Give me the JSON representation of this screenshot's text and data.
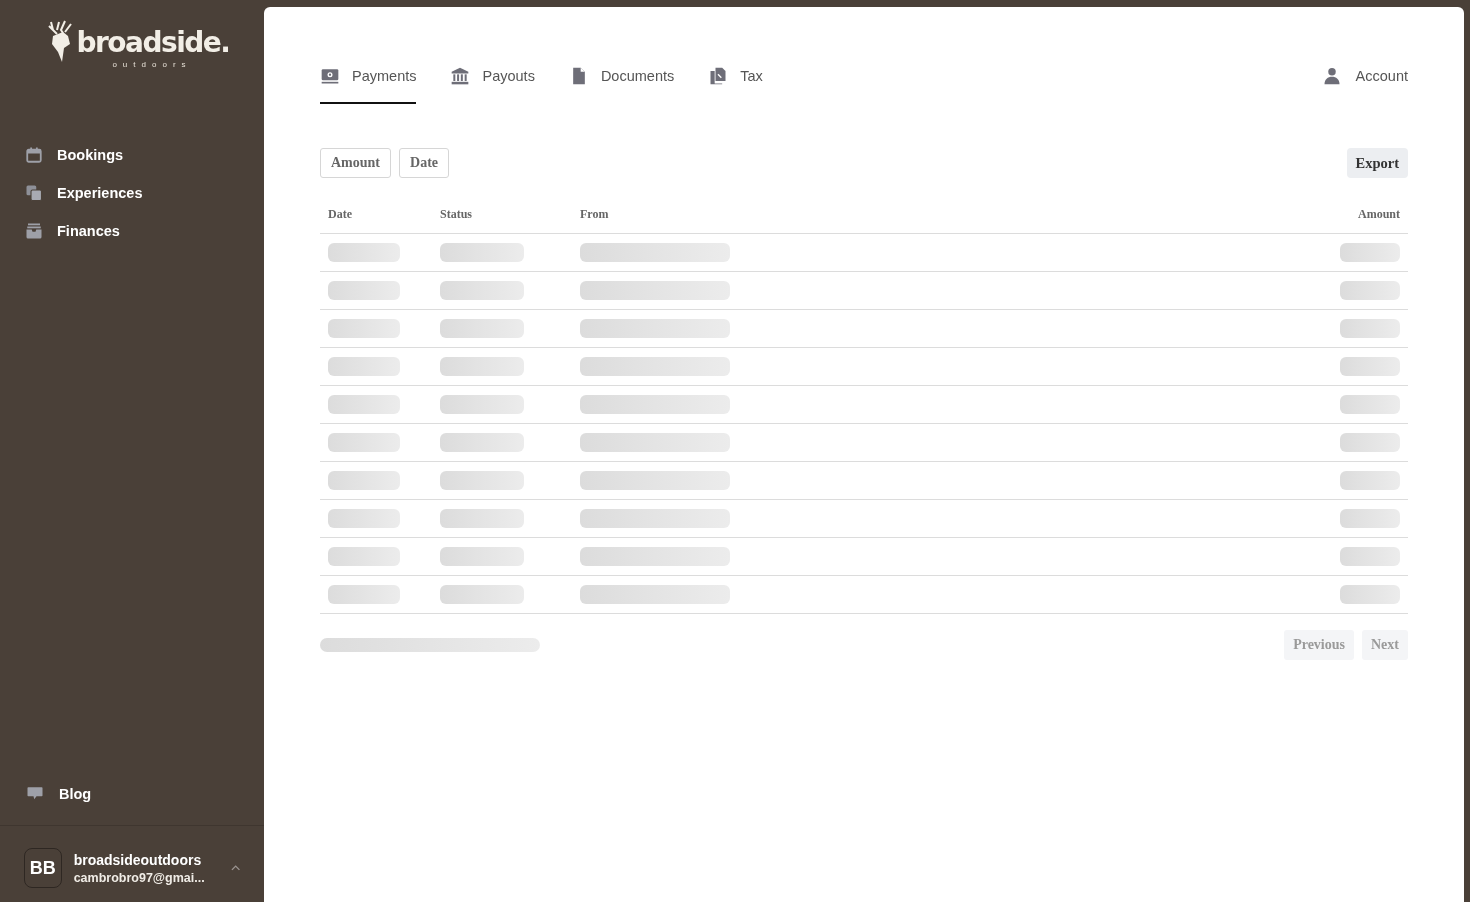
{
  "logo": {
    "name": "broadside.",
    "tagline": "outdoors"
  },
  "sidebar": {
    "items": [
      {
        "label": "Bookings",
        "kind": "calendar"
      },
      {
        "label": "Experiences",
        "kind": "copies"
      },
      {
        "label": "Finances",
        "kind": "tray"
      }
    ],
    "bottom_items": [
      {
        "label": "Blog",
        "kind": "chat"
      }
    ],
    "user": {
      "initials": "BB",
      "name": "broadsideoutdoors",
      "email": "cambrobro97@gmai..."
    }
  },
  "tabs": [
    {
      "label": "Payments",
      "kind": "money",
      "selected": true
    },
    {
      "label": "Payouts",
      "kind": "bank",
      "selected": false
    },
    {
      "label": "Documents",
      "kind": "file",
      "selected": false
    },
    {
      "label": "Tax",
      "kind": "files",
      "selected": false
    }
  ],
  "account": {
    "label": "Account"
  },
  "filters": [
    "Amount",
    "Date"
  ],
  "export": {
    "label": "Export"
  },
  "table": {
    "columns": [
      "Date",
      "Status",
      "From",
      "Amount"
    ],
    "rows": [
      {
        "kind": "skeleton"
      },
      {
        "kind": "skeleton"
      },
      {
        "kind": "skeleton"
      },
      {
        "kind": "skeleton"
      },
      {
        "kind": "skeleton"
      },
      {
        "kind": "skeleton"
      },
      {
        "kind": "skeleton"
      },
      {
        "kind": "skeleton"
      },
      {
        "kind": "skeleton"
      },
      {
        "kind": "skeleton"
      }
    ]
  },
  "pagination": {
    "previous": {
      "label": "Previous",
      "disabled": true
    },
    "next": {
      "label": "Next",
      "disabled": true
    }
  }
}
